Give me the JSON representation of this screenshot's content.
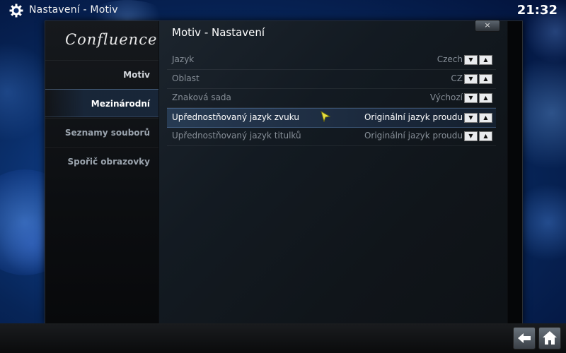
{
  "topbar": {
    "breadcrumb": "Nastavení  - Motiv",
    "clock": "21:32",
    "settings_icon": "gear-icon"
  },
  "dialog": {
    "title": "Motiv - Nastavení",
    "close_label": "×",
    "logo": "Confluence"
  },
  "sidebar": {
    "items": [
      {
        "label": "Motiv"
      },
      {
        "label": "Mezinárodní"
      },
      {
        "label": "Seznamy souborů"
      },
      {
        "label": "Spořič obrazovky"
      }
    ]
  },
  "settings": {
    "rows": [
      {
        "label": "Jazyk",
        "value": "Czech"
      },
      {
        "label": "Oblast",
        "value": "CZ"
      },
      {
        "label": "Znaková sada",
        "value": "Výchozí"
      },
      {
        "label": "Upřednostňovaný jazyk zvuku",
        "value": "Originální jazyk proudu",
        "selected": true
      },
      {
        "label": "Upřednostňovaný jazyk titulků",
        "value": "Originální jazyk proudu"
      }
    ],
    "spin_down": "▼",
    "spin_up": "▲"
  },
  "bottom": {
    "back_icon": "back-arrow-icon",
    "home_icon": "home-icon"
  }
}
